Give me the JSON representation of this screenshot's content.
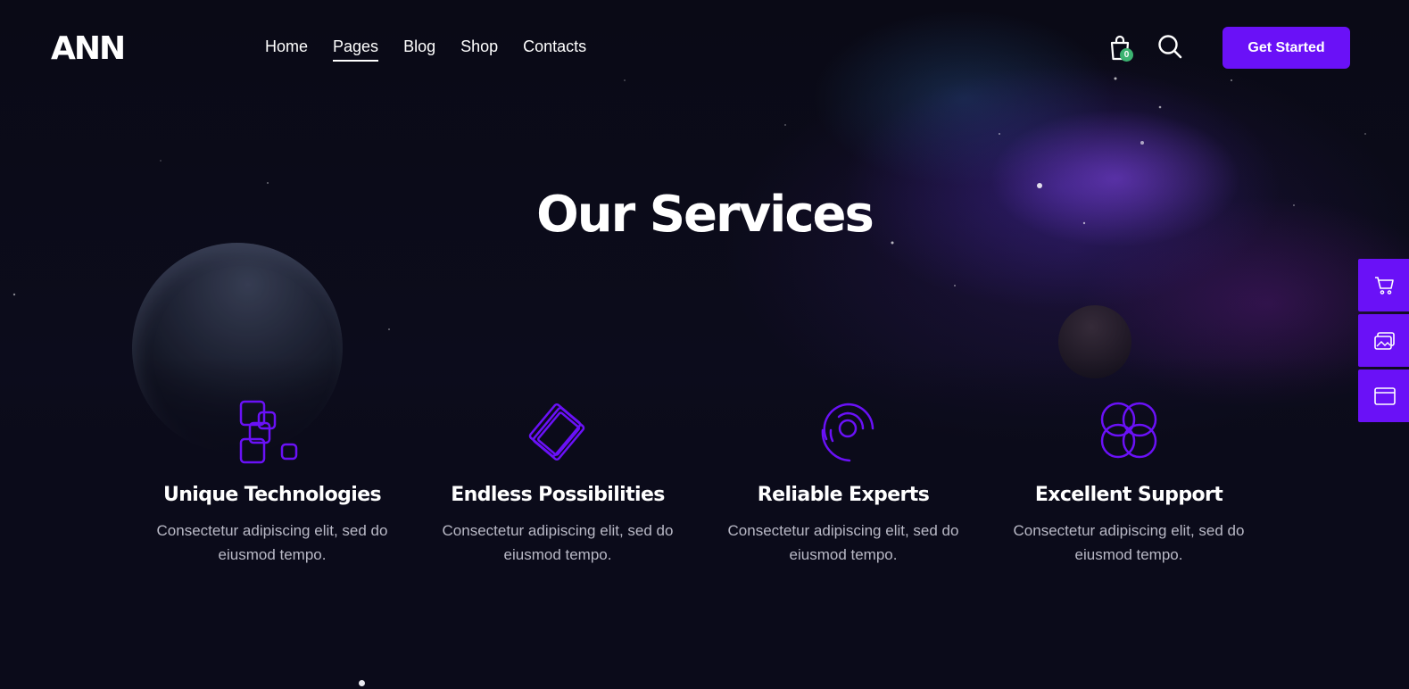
{
  "brand": {
    "logo_text": "ANN"
  },
  "nav": {
    "items": [
      {
        "label": "Home"
      },
      {
        "label": "Pages"
      },
      {
        "label": "Blog"
      },
      {
        "label": "Shop"
      },
      {
        "label": "Contacts"
      }
    ],
    "active": "Pages"
  },
  "header_actions": {
    "cart_icon": "shopping-bag-icon",
    "cart_count": "0",
    "search_icon": "search-icon",
    "cta_label": "Get Started"
  },
  "hero": {
    "title": "Our Services"
  },
  "services": [
    {
      "icon": "squares-icon",
      "title": "Unique Technologies",
      "text": "Consectetur adipiscing elit, sed do eiusmod tempo."
    },
    {
      "icon": "layers-icon",
      "title": "Endless Possibilities",
      "text": "Consectetur adipiscing elit, sed do eiusmod tempo."
    },
    {
      "icon": "spiral-icon",
      "title": "Reliable Experts",
      "text": "Consectetur adipiscing elit, sed do eiusmod tempo."
    },
    {
      "icon": "circles-icon",
      "title": "Excellent Support",
      "text": "Consectetur adipiscing elit, sed do eiusmod tempo."
    }
  ],
  "side_panel": [
    {
      "icon": "cart-icon"
    },
    {
      "icon": "image-icon"
    },
    {
      "icon": "window-icon"
    }
  ],
  "colors": {
    "accent": "#6a11f7",
    "badge": "#3cb371",
    "background": "#0b0b1a",
    "muted_text": "#b9b9c6"
  }
}
